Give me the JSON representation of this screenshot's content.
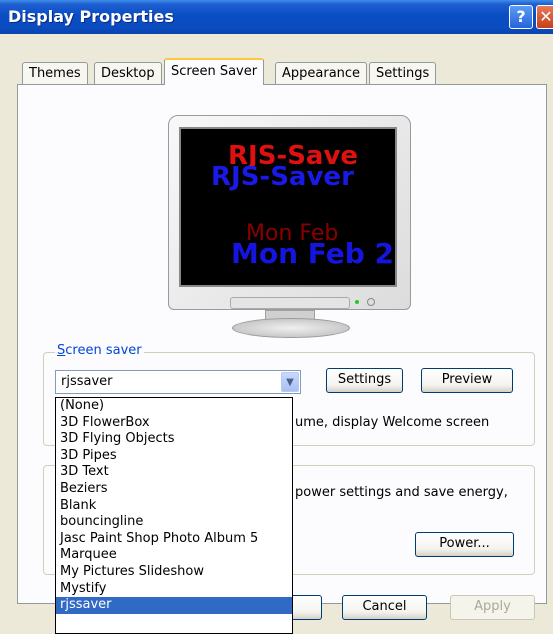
{
  "window": {
    "title": "Display Properties"
  },
  "tabs": [
    {
      "label": "Themes"
    },
    {
      "label": "Desktop"
    },
    {
      "label": "Screen Saver"
    },
    {
      "label": "Appearance"
    },
    {
      "label": "Settings"
    }
  ],
  "preview": {
    "line1": "RJS-Save",
    "line2": "RJS-Saver",
    "line3": "Mon Feb",
    "line4": "Mon Feb 2"
  },
  "screensaver": {
    "group_label_prefix": "S",
    "group_label_rest": "creen saver",
    "selected": "rjssaver",
    "settings_button": "Settings",
    "preview_button": "Preview",
    "resume_text": "ume, display Welcome screen",
    "options": [
      "(None)",
      "3D FlowerBox",
      "3D Flying Objects",
      "3D Pipes",
      "3D Text",
      "Beziers",
      "Blank",
      "bouncingline",
      "Jasc Paint Shop Photo Album 5",
      "Marquee",
      "My Pictures Slideshow",
      "Mystify",
      "rjssaver"
    ]
  },
  "power": {
    "text": "power settings and save energy,",
    "button": "Power..."
  },
  "footer": {
    "cancel": "Cancel",
    "apply": "Apply"
  },
  "colors": {
    "titlebar": "#0a4ec4",
    "selection": "#316ac5",
    "link": "#0046d5",
    "active_tab_accent": "#ffc83c"
  }
}
